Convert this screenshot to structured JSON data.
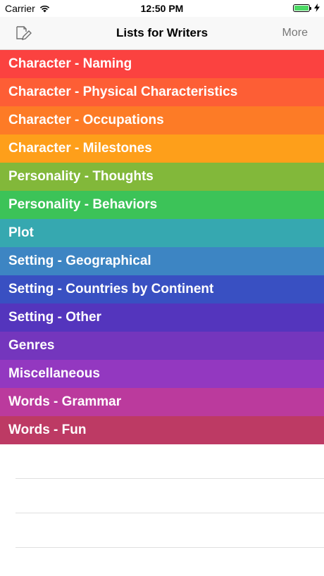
{
  "status_bar": {
    "carrier": "Carrier",
    "time": "12:50 PM",
    "wifi_icon": "wifi-icon",
    "battery_icon": "battery-icon",
    "charging_icon": "bolt-icon"
  },
  "nav": {
    "title": "Lists for Writers",
    "right_label": "More",
    "left_icon": "compose-icon"
  },
  "colors": {
    "battery_green": "#4cd964",
    "nav_background": "#f8f8f8"
  },
  "lists": [
    {
      "label": "Character - Naming",
      "color": "#fb4240"
    },
    {
      "label": "Character - Physical Characteristics",
      "color": "#fd5e35"
    },
    {
      "label": "Character - Occupations",
      "color": "#fd7b26"
    },
    {
      "label": "Character - Milestones",
      "color": "#fe9f1a"
    },
    {
      "label": "Personality - Thoughts",
      "color": "#82b83a"
    },
    {
      "label": "Personality - Behaviors",
      "color": "#3cc358"
    },
    {
      "label": "Plot",
      "color": "#36a8b0"
    },
    {
      "label": "Setting - Geographical",
      "color": "#3d85c3"
    },
    {
      "label": "Setting - Countries by Continent",
      "color": "#3950c2"
    },
    {
      "label": "Setting - Other",
      "color": "#5435bd"
    },
    {
      "label": "Genres",
      "color": "#7436bd"
    },
    {
      "label": "Miscellaneous",
      "color": "#9338c0"
    },
    {
      "label": "Words - Grammar",
      "color": "#bb3a9d"
    },
    {
      "label": "Words - Fun",
      "color": "#bd3a64"
    }
  ]
}
